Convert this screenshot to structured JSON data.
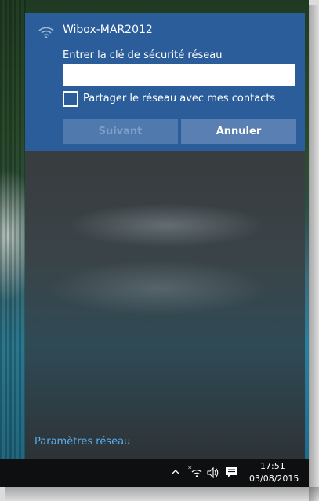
{
  "network": {
    "ssid": "Wibox-MAR2012",
    "key_label": "Entrer la clé de sécurité réseau",
    "key_value": "",
    "share_label": "Partager le réseau avec mes contacts",
    "share_checked": false,
    "next_label": "Suivant",
    "cancel_label": "Annuler",
    "icon": "wifi-secured-icon"
  },
  "footer": {
    "settings_link": "Paramètres réseau"
  },
  "taskbar": {
    "time": "17:51",
    "date": "03/08/2015",
    "tray_icons": [
      "chevron-up-icon",
      "wifi-icon",
      "volume-icon",
      "action-center-icon"
    ]
  },
  "colors": {
    "accent": "#2b5d9a",
    "link": "#5aaef0",
    "taskbar": "#0e0f10"
  }
}
